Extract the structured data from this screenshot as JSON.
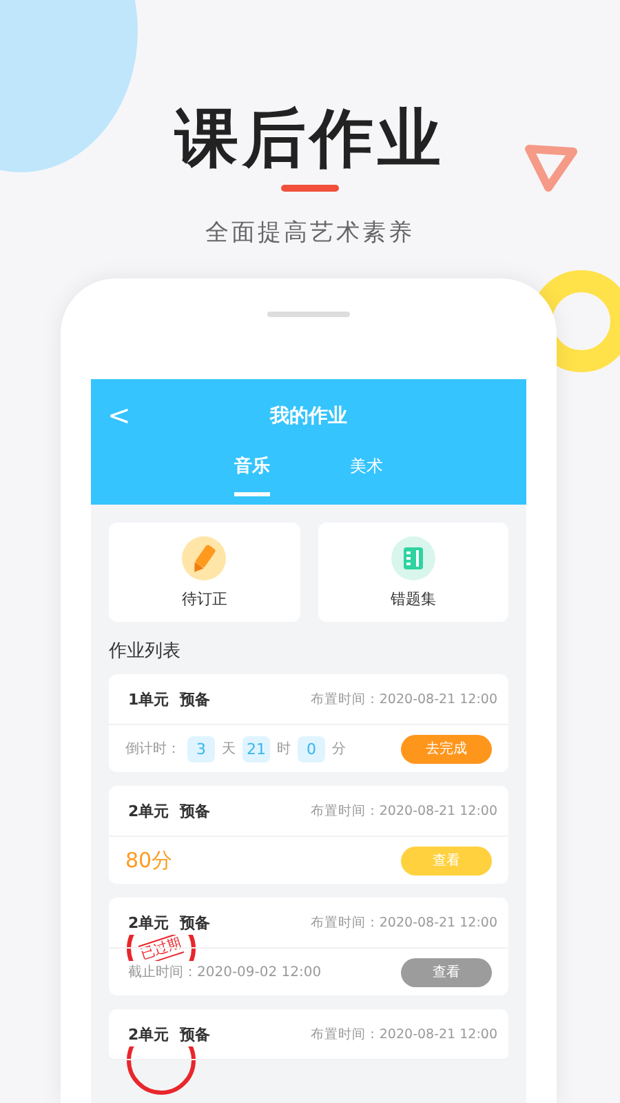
{
  "banner": {
    "title": "课后作业",
    "subtitle": "全面提高艺术素养"
  },
  "screen": {
    "back": "<",
    "title": "我的作业",
    "tabs": [
      {
        "label": "音乐",
        "selected": true
      },
      {
        "label": "美术",
        "selected": false
      }
    ],
    "shortcuts": [
      {
        "label": "待订正",
        "kind": "pencil"
      },
      {
        "label": "错题集",
        "kind": "notebook"
      }
    ],
    "section_title": "作业列表",
    "homework": [
      {
        "title": "1单元  预备",
        "assigned": "布置时间：2020-08-21 12:00",
        "expired": false,
        "footer": {
          "kind": "countdown",
          "prefix": "倒计时：",
          "parts": [
            {
              "value": "3",
              "unit": "天"
            },
            {
              "value": "21",
              "unit": "时"
            },
            {
              "value": "0",
              "unit": "分"
            }
          ]
        },
        "button": {
          "label": "去完成",
          "kind": "primary"
        }
      },
      {
        "title": "2单元  预备",
        "assigned": "布置时间：2020-08-21 12:00",
        "expired": false,
        "footer": {
          "kind": "score",
          "text": "80分"
        },
        "button": {
          "label": "查看",
          "kind": "secondary"
        }
      },
      {
        "title": "2单元  预备",
        "assigned": "布置时间：2020-08-21 12:00",
        "expired": true,
        "stamp": "已过期",
        "footer": {
          "kind": "deadline",
          "text": "截止时间：2020-09-02 12:00"
        },
        "button": {
          "label": "查看",
          "kind": "disabled"
        }
      },
      {
        "title": "2单元  预备",
        "assigned": "布置时间：2020-08-21 12:00",
        "expired": true
      }
    ]
  }
}
